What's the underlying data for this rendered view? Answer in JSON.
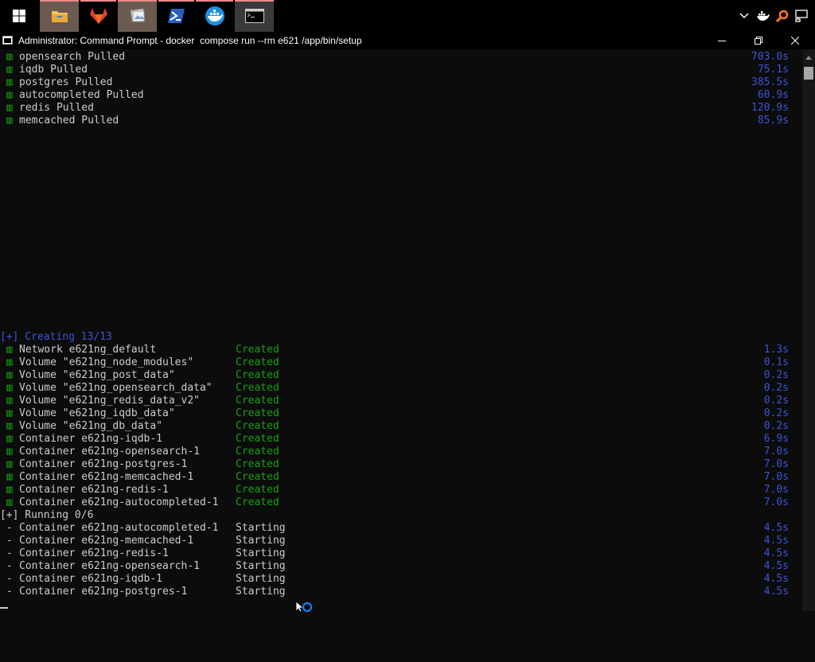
{
  "taskbar": {
    "apps": [
      {
        "name": "file-explorer"
      },
      {
        "name": "gitlab"
      },
      {
        "name": "image-viewer"
      },
      {
        "name": "powershell"
      },
      {
        "name": "docker-desktop"
      },
      {
        "name": "command-prompt"
      }
    ]
  },
  "window": {
    "title": "Administrator: Command Prompt - docker  compose run --rm e621 /app/bin/setup"
  },
  "colors": {
    "green": "#13a10e",
    "blue": "#3b54d8",
    "text": "#cccccc",
    "background": "#0c0c0c"
  },
  "terminal": {
    "check_marker": "▥",
    "pulled": [
      {
        "name": "opensearch Pulled",
        "time": "703.0s"
      },
      {
        "name": "iqdb Pulled",
        "time": "75.1s"
      },
      {
        "name": "postgres Pulled",
        "time": "385.5s"
      },
      {
        "name": "autocompleted Pulled",
        "time": "60.9s"
      },
      {
        "name": "redis Pulled",
        "time": "120.9s"
      },
      {
        "name": "memcached Pulled",
        "time": "85.9s"
      }
    ],
    "creating_header": "[+] Creating 13/13",
    "created": [
      {
        "name": "Network e621ng_default",
        "status": "Created",
        "time": "1.3s"
      },
      {
        "name": "Volume \"e621ng_node_modules\"",
        "status": "Created",
        "time": "0.1s"
      },
      {
        "name": "Volume \"e621ng_post_data\"",
        "status": "Created",
        "time": "0.2s"
      },
      {
        "name": "Volume \"e621ng_opensearch_data\"",
        "status": "Created",
        "time": "0.2s"
      },
      {
        "name": "Volume \"e621ng_redis_data_v2\"",
        "status": "Created",
        "time": "0.2s"
      },
      {
        "name": "Volume \"e621ng_iqdb_data\"",
        "status": "Created",
        "time": "0.2s"
      },
      {
        "name": "Volume \"e621ng_db_data\"",
        "status": "Created",
        "time": "0.2s"
      },
      {
        "name": "Container e621ng-iqdb-1",
        "status": "Created",
        "time": "6.9s"
      },
      {
        "name": "Container e621ng-opensearch-1",
        "status": "Created",
        "time": "7.0s"
      },
      {
        "name": "Container e621ng-postgres-1",
        "status": "Created",
        "time": "7.0s"
      },
      {
        "name": "Container e621ng-memcached-1",
        "status": "Created",
        "time": "7.0s"
      },
      {
        "name": "Container e621ng-redis-1",
        "status": "Created",
        "time": "7.0s"
      },
      {
        "name": "Container e621ng-autocompleted-1",
        "status": "Created",
        "time": "7.0s"
      }
    ],
    "running_header": "[+] Running 0/6",
    "running_marker": "-",
    "running": [
      {
        "name": "Container e621ng-autocompleted-1",
        "status": "Starting",
        "time": "4.5s"
      },
      {
        "name": "Container e621ng-memcached-1",
        "status": "Starting",
        "time": "4.5s"
      },
      {
        "name": "Container e621ng-redis-1",
        "status": "Starting",
        "time": "4.5s"
      },
      {
        "name": "Container e621ng-opensearch-1",
        "status": "Starting",
        "time": "4.5s"
      },
      {
        "name": "Container e621ng-iqdb-1",
        "status": "Starting",
        "time": "4.5s"
      },
      {
        "name": "Container e621ng-postgres-1",
        "status": "Starting",
        "time": "4.5s"
      }
    ]
  }
}
